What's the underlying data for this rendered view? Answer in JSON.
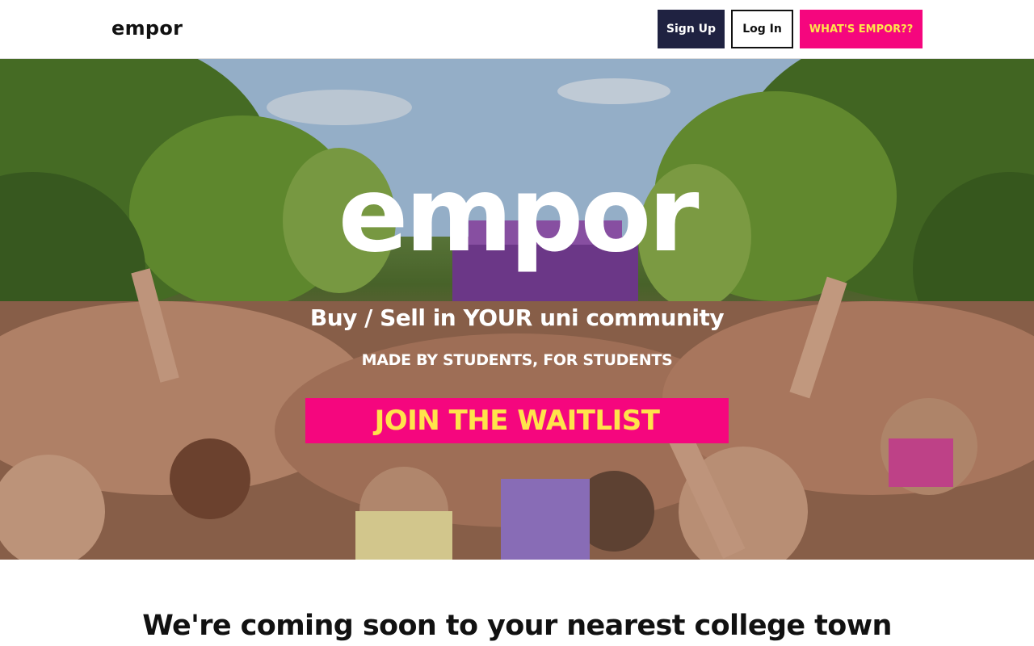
{
  "header": {
    "logo": "empor",
    "signup_label": "Sign Up",
    "login_label": "Log In",
    "whats_label": "WHAT'S EMPOR??"
  },
  "hero": {
    "title": "empor",
    "subtitle": "Buy / Sell in YOUR uni community",
    "tagline": "MADE BY STUDENTS, FOR STUDENTS",
    "cta_label": "JOIN THE WAITLIST",
    "image": "crowd-celebration-photo"
  },
  "section": {
    "heading": "We're coming soon to your nearest college town"
  },
  "colors": {
    "navy": "#1f2241",
    "magenta": "#f5067e",
    "yellow": "#ffe34b",
    "white": "#ffffff",
    "black": "#111111"
  }
}
